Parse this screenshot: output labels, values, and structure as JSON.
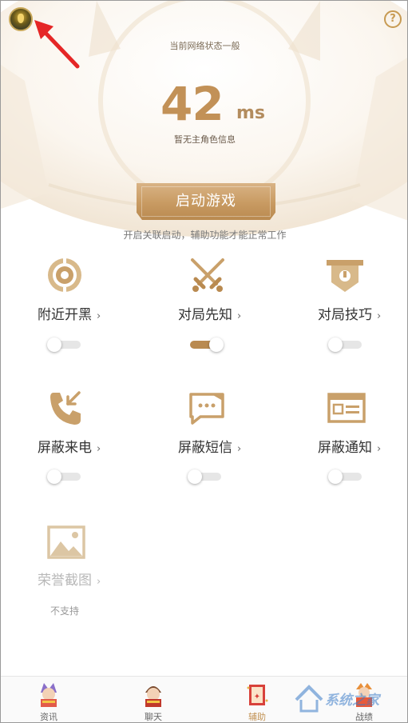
{
  "header": {
    "network_status": "当前网络状态一般",
    "ping_value": "42",
    "ping_unit": "ms",
    "role_info": "暂无主角色信息",
    "help_glyph": "?"
  },
  "start": {
    "label": "启动游戏",
    "hint": "开启关联启动，辅助功能才能正常工作"
  },
  "features": [
    {
      "label": "附近开黑",
      "icon": "target-icon",
      "enabled": false
    },
    {
      "label": "对局先知",
      "icon": "crossed-swords-icon",
      "enabled": true
    },
    {
      "label": "对局技巧",
      "icon": "banner-icon",
      "enabled": false
    },
    {
      "label": "屏蔽来电",
      "icon": "phone-incoming-icon",
      "enabled": false
    },
    {
      "label": "屏蔽短信",
      "icon": "message-icon",
      "enabled": false
    },
    {
      "label": "屏蔽通知",
      "icon": "notification-card-icon",
      "enabled": false
    },
    {
      "label": "荣誉截图",
      "icon": "image-icon",
      "enabled": false,
      "note": "不支持"
    }
  ],
  "chevron": "›",
  "tabs": [
    {
      "label": "资讯",
      "active": false
    },
    {
      "label": "聊天",
      "active": false
    },
    {
      "label": "辅助",
      "active": true
    },
    {
      "label": "战绩",
      "active": false
    }
  ],
  "watermark": {
    "text": "系统之家"
  },
  "colors": {
    "accent": "#c29157",
    "toggle_on": "#b98a50",
    "toggle_off": "#e6e6e6"
  }
}
